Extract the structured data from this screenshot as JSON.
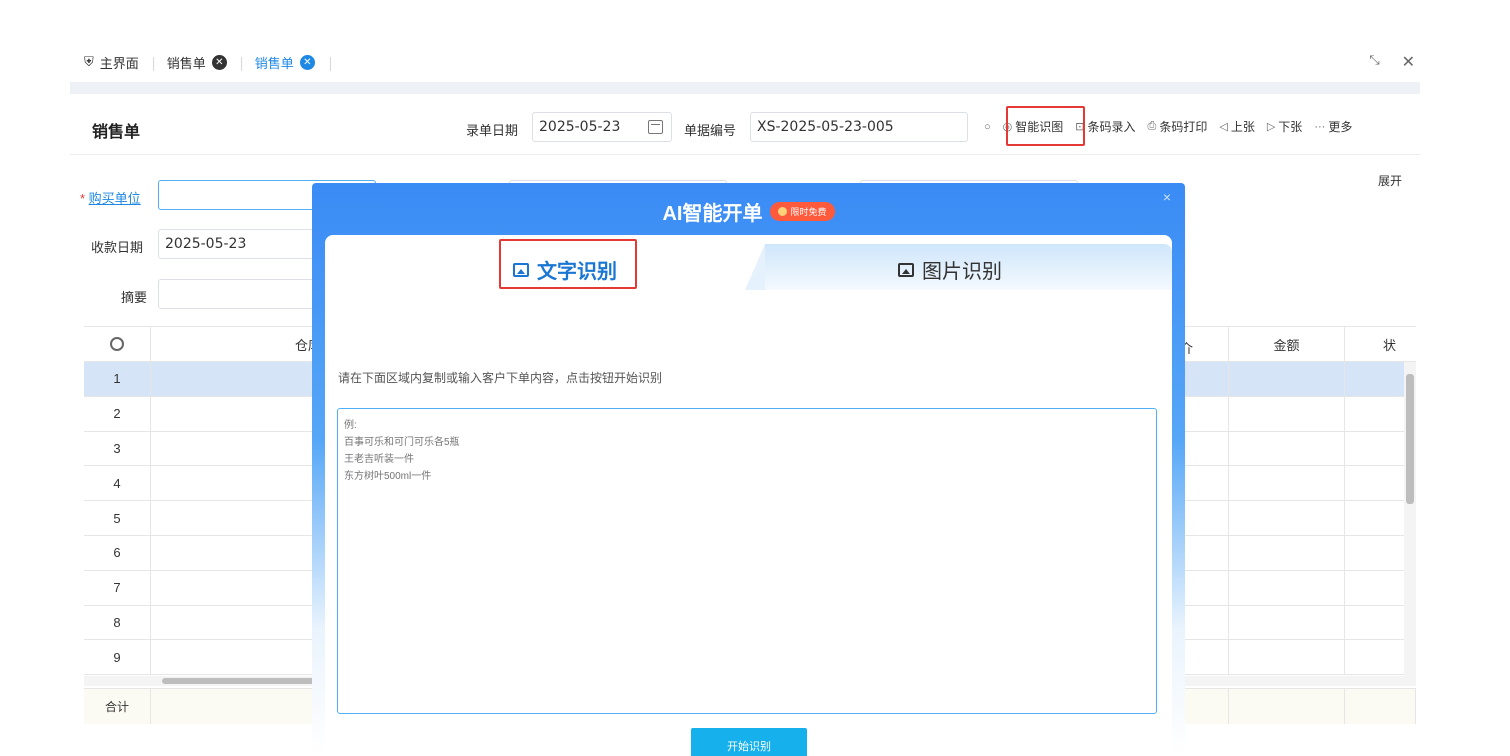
{
  "tabs": [
    {
      "label": "主界面",
      "icon": "home-icon"
    },
    {
      "label": "销售单",
      "icon": "close-circle-icon"
    },
    {
      "label": "销售单",
      "icon": "close-circle-icon",
      "active": true
    }
  ],
  "window": {
    "fullscreen_icon": "⛶",
    "close_icon": "✕"
  },
  "toolbar": {
    "title": "销售单",
    "date_label": "录单日期",
    "date_value": "2025-05-23",
    "docno_label": "单据编号",
    "docno_value": "XS-2025-05-23-005",
    "refresh_icon": "refresh-icon",
    "buttons": [
      {
        "label": "智能识图",
        "icon": "ai-icon",
        "highlighted": true
      },
      {
        "label": "条码录入",
        "icon": "scan-icon"
      },
      {
        "label": "条码打印",
        "icon": "print-icon"
      },
      {
        "label": "上张",
        "icon": "prev-icon"
      },
      {
        "label": "下张",
        "icon": "next-icon"
      },
      {
        "label": "更多",
        "icon": "more-icon"
      }
    ]
  },
  "form": {
    "buyer_label": "购买单位",
    "buyer_value": "",
    "receipt_date_label": "收款日期",
    "receipt_date_value": "2025-05-23",
    "summary_label": "摘要",
    "summary_value": "",
    "expand_label": "展开"
  },
  "table": {
    "headers": [
      "仓库全名",
      "介",
      "金额",
      "状"
    ],
    "rows": [
      "1",
      "2",
      "3",
      "4",
      "5",
      "6",
      "7",
      "8",
      "9"
    ],
    "selected_row": 0,
    "footer_label": "合计"
  },
  "modal": {
    "title": "AI智能开单",
    "badge": "限时免费",
    "tab_text": "文字识别",
    "tab_image": "图片识别",
    "hint": "请在下面区域内复制或输入客户下单内容，点击按钮开始识别",
    "placeholder": "例:\n百事可乐和可门可乐各5瓶\n王老吉听装一件\n东方树叶500ml一件",
    "start_button": "开始识别",
    "close_icon": "×"
  }
}
